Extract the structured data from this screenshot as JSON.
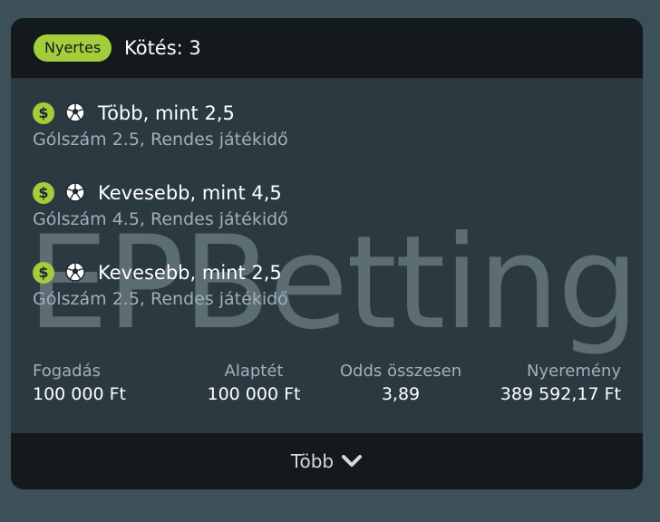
{
  "header": {
    "status_badge": "Nyertes",
    "title": "Kötés: 3"
  },
  "watermark": "EPBetting",
  "selections": [
    {
      "name": "Több, mint 2,5",
      "market": "Gólszám 2.5, Rendes játékidő",
      "icons": [
        "dollar-icon",
        "soccer-ball-icon"
      ]
    },
    {
      "name": "Kevesebb, mint 4,5",
      "market": "Gólszám 4.5, Rendes játékidő",
      "icons": [
        "dollar-icon",
        "soccer-ball-icon"
      ]
    },
    {
      "name": "Kevesebb, mint 2,5",
      "market": "Gólszám 2.5, Rendes játékidő",
      "icons": [
        "dollar-icon",
        "soccer-ball-icon"
      ]
    }
  ],
  "stats": {
    "stake": {
      "label": "Fogadás",
      "value": "100 000 Ft"
    },
    "base_stake": {
      "label": "Alaptét",
      "value": "100 000 Ft"
    },
    "total_odds": {
      "label": "Odds összesen",
      "value": "3,89"
    },
    "winnings": {
      "label": "Nyeremény",
      "value": "389 592,17 Ft"
    }
  },
  "footer": {
    "more_label": "Több"
  },
  "colors": {
    "accent": "#a3cd3a",
    "card_bg": "#2b3a41",
    "header_bg": "#13191d",
    "page_bg": "#3d4f57",
    "muted_text": "#9fb0b8"
  }
}
